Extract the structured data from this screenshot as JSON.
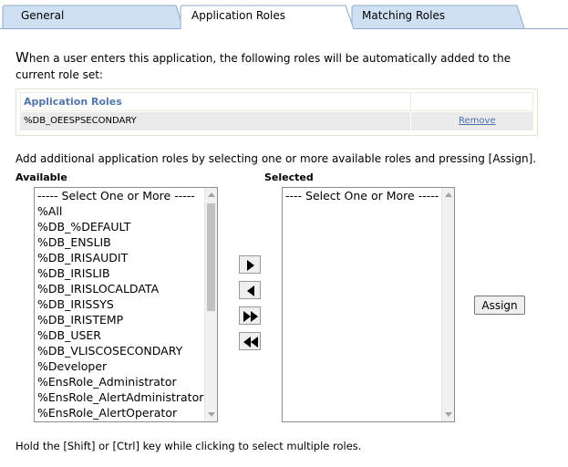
{
  "tabs": [
    {
      "label": "General"
    },
    {
      "label": "Application Roles"
    },
    {
      "label": "Matching Roles"
    }
  ],
  "intro": {
    "first_letter": "W",
    "text": "hen a user enters this application, the following roles will be automatically added to the current role set:"
  },
  "application_roles_table": {
    "header": "Application Roles",
    "rows": [
      {
        "name": "%DB_OEESPSECONDARY",
        "action": "Remove"
      }
    ]
  },
  "add_text": "Add additional application roles by selecting one or more available roles and pressing [Assign].",
  "available": {
    "label": "Available",
    "options": [
      "----- Select One or More -----",
      "%All",
      "%DB_%DEFAULT",
      "%DB_ENSLIB",
      "%DB_IRISAUDIT",
      "%DB_IRISLIB",
      "%DB_IRISLOCALDATA",
      "%DB_IRISSYS",
      "%DB_IRISTEMP",
      "%DB_USER",
      "%DB_VLISCOSECONDARY",
      "%Developer",
      "%EnsRole_Administrator",
      "%EnsRole_AlertAdministrator",
      "%EnsRole_AlertOperator"
    ]
  },
  "selected": {
    "label": "Selected",
    "options": [
      "---- Select One or More -----"
    ]
  },
  "move_buttons": [
    "move-right-icon",
    "move-left-icon",
    "move-all-right-icon",
    "move-all-left-icon"
  ],
  "assign_label": "Assign",
  "hint": "Hold the [Shift] or [Ctrl] key while clicking to select multiple roles.",
  "colors": {
    "tab_inactive": "#cfe0f3",
    "tab_border": "#8fa9c8",
    "header_text": "#5277aa",
    "link": "#4a6eb0",
    "row_bg": "#ebebeb"
  }
}
